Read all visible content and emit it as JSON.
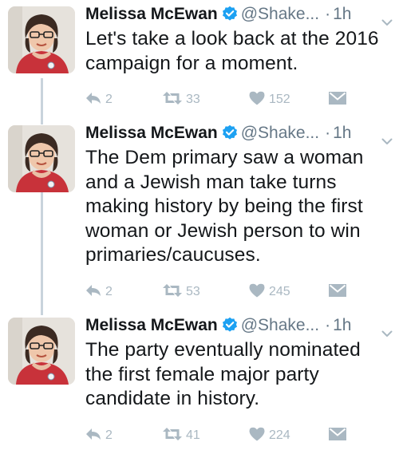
{
  "tweets": [
    {
      "author": "Melissa McEwan",
      "handle": "@Shake...",
      "dot": "·",
      "time": "1h",
      "text": "Let's take a look back at the 2016 campaign for a moment.",
      "replies": "2",
      "retweets": "33",
      "likes": "152"
    },
    {
      "author": "Melissa McEwan",
      "handle": "@Shake...",
      "dot": "·",
      "time": "1h",
      "text": "The Dem primary saw a woman and a Jewish man take turns making history by being the first woman or Jewish person to win primaries/caucuses.",
      "replies": "2",
      "retweets": "53",
      "likes": "245"
    },
    {
      "author": "Melissa McEwan",
      "handle": "@Shake...",
      "dot": "·",
      "time": "1h",
      "text": "The party eventually nominated the first female major party candidate in history.",
      "replies": "2",
      "retweets": "41",
      "likes": "224"
    }
  ],
  "colors": {
    "verified": "#1da1f2",
    "muted": "#657786",
    "action": "#aab8c2",
    "thread_line": "#c9d3dc"
  },
  "icons": [
    "verified-icon",
    "chevron-down-icon",
    "reply-icon",
    "retweet-icon",
    "like-icon",
    "direct-message-icon"
  ]
}
